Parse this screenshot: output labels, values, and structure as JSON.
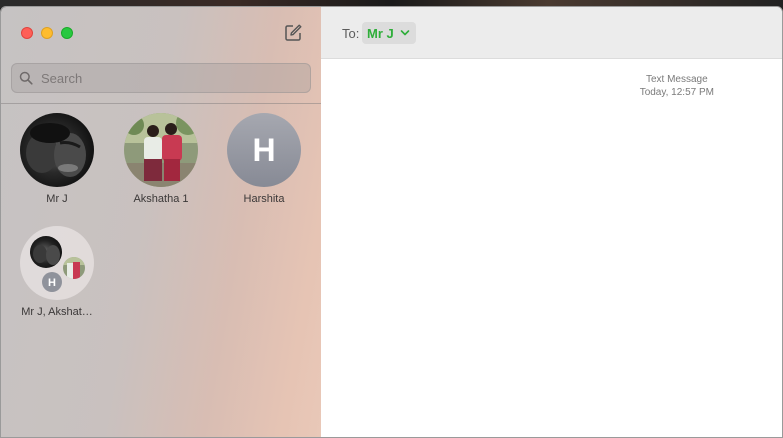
{
  "window": {
    "controls": [
      "close",
      "minimize",
      "maximize"
    ]
  },
  "sidebar": {
    "compose_icon": "compose-icon",
    "search": {
      "placeholder": "Search",
      "icon": "search-icon"
    },
    "contacts": [
      {
        "name": "Mr J",
        "avatar_type": "photo-dark"
      },
      {
        "name": "Akshatha 1",
        "avatar_type": "photo-outdoor"
      },
      {
        "name": "Harshita",
        "avatar_type": "letter",
        "initial": "H"
      },
      {
        "name": "Mr J, Akshat…",
        "avatar_type": "group",
        "initial": "H"
      }
    ]
  },
  "conversation": {
    "to_label": "To:",
    "recipient": "Mr J",
    "service": "Text Message",
    "timestamp": "Today, 12:57 PM",
    "accent_color": "#2fae3a"
  }
}
